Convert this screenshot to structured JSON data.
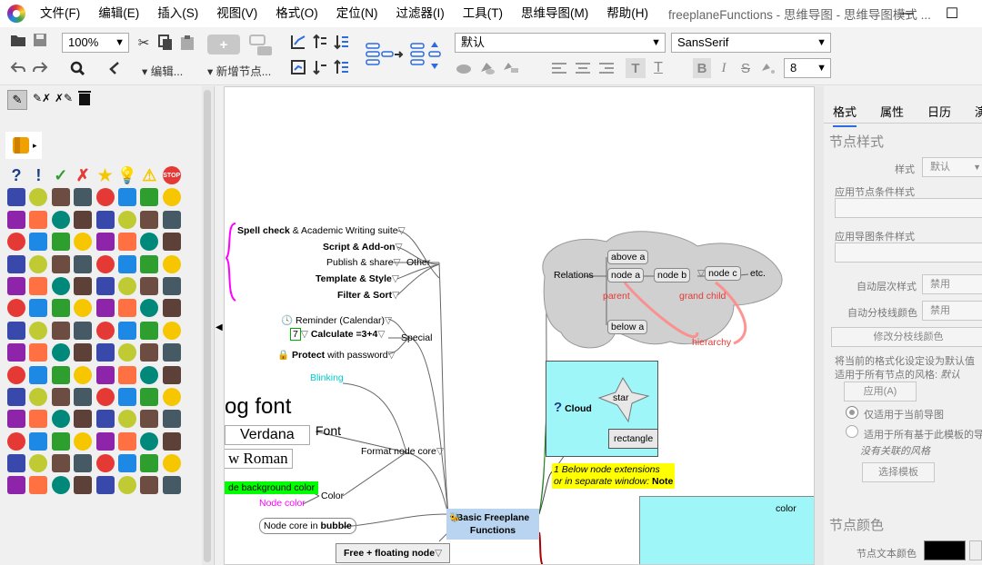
{
  "menu": [
    "文件(F)",
    "编辑(E)",
    "插入(S)",
    "视图(V)",
    "格式(O)",
    "定位(N)",
    "过滤器(I)",
    "工具(T)",
    "思维导图(M)",
    "帮助(H)"
  ],
  "window_title": "freeplaneFunctions - 思维导图 - 思维导图模式 ...",
  "window_buttons": {
    "minimize": "—",
    "maximize": "☐"
  },
  "toolbar": {
    "zoom": "100%",
    "edit_label": "▾ 编辑...",
    "new_node_label": "▾ 新增节点...",
    "style_value": "默认",
    "font_value": "SansSerif",
    "font_size": "8"
  },
  "icons_legend": [
    "?",
    "!",
    "✓",
    "✗",
    "★",
    "💡",
    "⚠",
    "STOP"
  ],
  "canvas": {
    "left_nodes": {
      "spell_check": "Spell check",
      "spell_rest": " & Academic Writing suite",
      "script": "Script & Add-on",
      "publish": "Publish & share",
      "template": "Template & Style",
      "filter": "Filter & Sort",
      "other": "Other",
      "reminder": "Reminder (Calendar)",
      "calc_num": "7",
      "calculate": "Calculate =3+4",
      "protect": "Protect",
      "protect_rest": " with password",
      "special": "Special",
      "blinking": "Blinking",
      "big_font": "og font",
      "verdana": "Verdana",
      "roman": "w Roman",
      "font": "Font",
      "format_core": "Format node core",
      "bg_color": "de background color",
      "node_color": "Node color",
      "color": "Color",
      "bubble": "Node core in ",
      "bubble_b": "bubble",
      "free_floating": "Free + floating node"
    },
    "right_nodes": {
      "relations": "Relations",
      "above_a": "above a",
      "node_a": "node a",
      "node_b": "node b",
      "node_c": "node c",
      "etc": "etc.",
      "parent": "parent",
      "grand_child": "grand child",
      "below_a": "below a",
      "hierarchy": "hierarchy",
      "cloud": "Cloud",
      "star": "star",
      "rectangle": "rectangle",
      "below_node_1": "1 Below node extensions",
      "below_node_2": "or in separate window: ",
      "below_node_note": "Note",
      "color_node": "color"
    },
    "root": {
      "line1": "Basic Freeplane",
      "line2": "Functions"
    }
  },
  "right_panel": {
    "tabs": [
      "格式",
      "属性",
      "日历",
      "演"
    ],
    "section_node_style": "节点样式",
    "style_label": "样式",
    "style_value": "默认",
    "apply_node_cond": "应用节点条件样式",
    "apply_map_cond": "应用导图条件样式",
    "auto_level": "自动层次样式",
    "auto_level_value": "禁用",
    "auto_branch": "自动分枝线颜色",
    "auto_branch_value": "禁用",
    "modify_branch": "修改分枝线颜色",
    "set_default": "将当前的格式化设定设为默认值",
    "apply_all": "适用于所有节点的风格: ",
    "apply_all_value": "默认",
    "apply_btn": "应用(A)",
    "only_current": "仅适用于当前导图",
    "all_template": "适用于所有基于此模板的导图",
    "no_assoc": "没有关联的风格",
    "choose_template": "选择模板",
    "section_node_color": "节点颜色",
    "text_color": "节点文本颜色"
  },
  "colors": {
    "accent": "#2d6cdf",
    "cloud": "#d0d0d0",
    "cyan": "#9ff6f8",
    "yellow": "#ffff00",
    "magenta": "#ff00ff",
    "root_bg": "#b9d4f0"
  }
}
